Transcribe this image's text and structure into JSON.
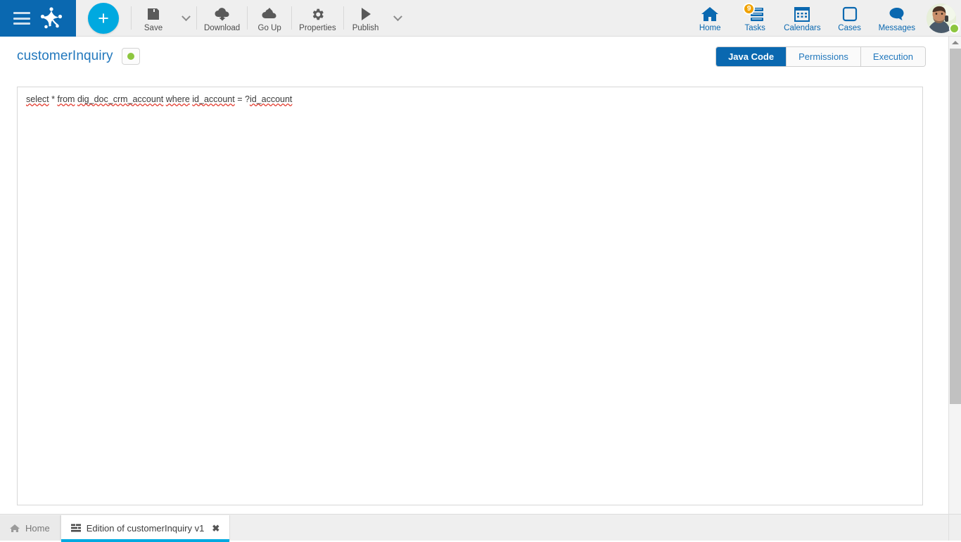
{
  "topbar": {
    "menu_icon": "hamburger-icon",
    "logo_icon": "bonita-logo-icon",
    "create_label": "+",
    "tools": [
      {
        "label": "Save",
        "icon": "save-floppy-icon"
      },
      {
        "label": "Download",
        "icon": "cloud-download-icon"
      },
      {
        "label": "Go Up",
        "icon": "cloud-upload-icon"
      },
      {
        "label": "Properties",
        "icon": "gear-icon"
      },
      {
        "label": "Publish",
        "icon": "play-triangle-icon"
      }
    ],
    "nav": [
      {
        "label": "Home",
        "icon": "home-icon",
        "badge": ""
      },
      {
        "label": "Tasks",
        "icon": "tasks-list-icon",
        "badge": "9"
      },
      {
        "label": "Calendars",
        "icon": "calendar-icon",
        "badge": ""
      },
      {
        "label": "Cases",
        "icon": "case-square-icon",
        "badge": ""
      },
      {
        "label": "Messages",
        "icon": "chat-bubble-icon",
        "badge": ""
      }
    ],
    "avatar": {
      "icon": "user-avatar",
      "status": "online"
    }
  },
  "page": {
    "title": "customerInquiry",
    "status_color": "#8dc63f",
    "tabs": [
      {
        "label": "Java Code",
        "active": true
      },
      {
        "label": "Permissions",
        "active": false
      },
      {
        "label": "Execution",
        "active": false
      }
    ]
  },
  "editor": {
    "code_tokens": [
      {
        "text": "select",
        "spell": true
      },
      {
        "text": " * ",
        "spell": false
      },
      {
        "text": "from",
        "spell": true
      },
      {
        "text": " ",
        "spell": false
      },
      {
        "text": "dig_doc_crm_account",
        "spell": true
      },
      {
        "text": " ",
        "spell": false
      },
      {
        "text": "where",
        "spell": true
      },
      {
        "text": " ",
        "spell": false
      },
      {
        "text": "id_account",
        "spell": true
      },
      {
        "text": " = ?",
        "spell": false
      },
      {
        "text": "id_account",
        "spell": true
      }
    ],
    "code_text": "select * from dig_doc_crm_account where id_account = ?id_account"
  },
  "taskbar": {
    "tabs": [
      {
        "label": "Home",
        "icon": "home-small-icon",
        "active": false,
        "closable": false
      },
      {
        "label": "Edition of customerInquiry v1",
        "icon": "form-lines-icon",
        "active": true,
        "closable": true,
        "close_glyph": "✖"
      }
    ]
  },
  "colors": {
    "brand_blue": "#0a68b0",
    "accent_cyan": "#00a9e0",
    "badge_orange": "#f0a202",
    "status_green": "#8dc63f",
    "spell_red": "#e33b2e"
  }
}
